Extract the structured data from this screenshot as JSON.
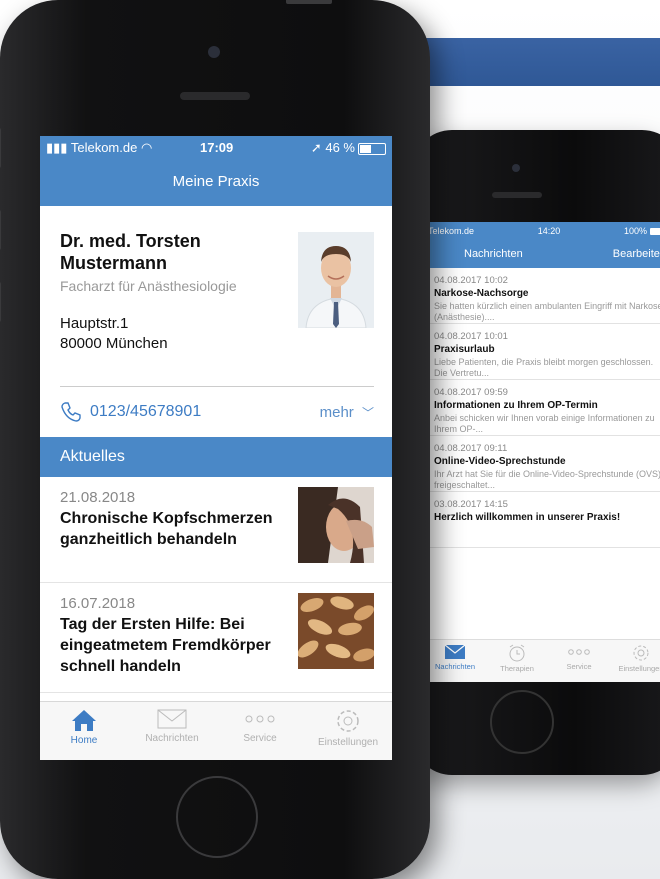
{
  "back_phone": {
    "status": {
      "carrier": "Telekom.de",
      "time": "14:20",
      "battery": "100%"
    },
    "nav": {
      "title": "Nachrichten",
      "edit_label": "Bearbeiten"
    },
    "messages": [
      {
        "date": "04.08.2017 10:02",
        "subject": "Narkose-Nachsorge",
        "preview": "Sie hatten kürzlich einen ambulanten Eingriff mit Narkose (Anästhesie)...."
      },
      {
        "date": "04.08.2017 10:01",
        "subject": "Praxisurlaub",
        "preview": "Liebe Patienten, die Praxis bleibt morgen geschlossen. Die Vertretu..."
      },
      {
        "date": "04.08.2017 09:59",
        "subject": "Informationen zu Ihrem OP-Termin",
        "preview": "Anbei schicken wir Ihnen vorab einige Informationen zu Ihrem OP-..."
      },
      {
        "date": "04.08.2017 09:11",
        "subject": "Online-Video-Sprechstunde",
        "preview": "Ihr Arzt hat Sie für die Online-Video-Sprechstunde (OVS) freigeschaltet..."
      },
      {
        "date": "03.08.2017 14:15",
        "subject": "Herzlich willkommen in unserer Praxis!",
        "preview": ""
      }
    ],
    "tabs": [
      {
        "label": "Nachrichten",
        "icon": "envelope-icon"
      },
      {
        "label": "Therapien",
        "icon": "alarm-clock-icon"
      },
      {
        "label": "Service",
        "icon": "dots-icon"
      },
      {
        "label": "Einstellungen",
        "icon": "gear-icon"
      }
    ]
  },
  "front_phone": {
    "status": {
      "carrier": "Telekom.de",
      "time": "17:09",
      "battery": "46 %"
    },
    "nav": {
      "title": "Meine Praxis"
    },
    "doctor": {
      "name": "Dr. med. Torsten Mustermann",
      "specialty": "Facharzt für Anästhesiologie",
      "street": "Hauptstr.1",
      "city": "80000 München"
    },
    "contact": {
      "phone": "0123/45678901",
      "more_label": "mehr"
    },
    "section_title": "Aktuelles",
    "news": [
      {
        "date": "21.08.2018",
        "title": "Chronische Kopfschmerzen ganzheitlich behandeln"
      },
      {
        "date": "16.07.2018",
        "title": "Tag der Ersten Hilfe: Bei eingeatmetem Fremdkörper schnell handeln"
      }
    ],
    "tabs": [
      {
        "label": "Home",
        "icon": "home-icon"
      },
      {
        "label": "Nachrichten",
        "icon": "envelope-icon"
      },
      {
        "label": "Service",
        "icon": "dots-icon"
      },
      {
        "label": "Einstellungen",
        "icon": "gear-icon"
      }
    ]
  },
  "colors": {
    "accent": "#4a88c7",
    "link": "#3d7cc4",
    "banner": "#2f5896"
  }
}
